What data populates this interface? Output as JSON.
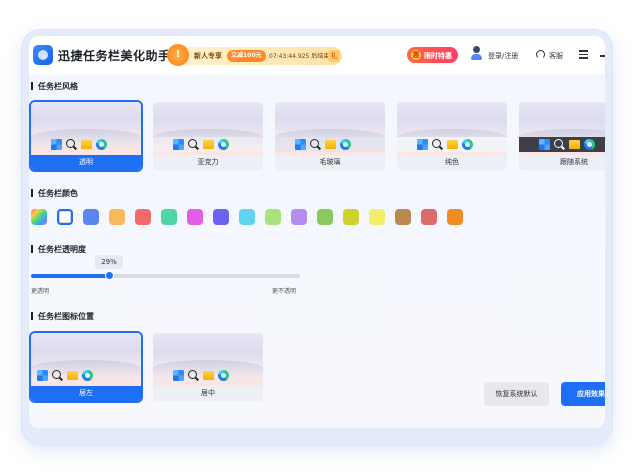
{
  "header": {
    "app_title": "迅捷任务栏美化助手",
    "promo_badge": "!",
    "promo_label": "新人专享",
    "promo_cta": "立减100元",
    "promo_timer": "07:43:44.925 后结束",
    "promo_tail": "礼",
    "limited_icon": "惠",
    "limited_label": "限时特惠",
    "login_label": "登录/注册",
    "service_label": "客服"
  },
  "sections": {
    "style_title": "任务栏风格",
    "color_title": "任务栏颜色",
    "opacity_title": "任务栏透明度",
    "position_title": "任务栏图标位置"
  },
  "styles": [
    {
      "label": "透明",
      "selected": true
    },
    {
      "label": "亚克力",
      "selected": false
    },
    {
      "label": "毛玻璃",
      "selected": false
    },
    {
      "label": "纯色",
      "selected": false
    },
    {
      "label": "跟随系统",
      "selected": false
    }
  ],
  "colors": [
    "rainbow",
    "#ffffff",
    "#5b86f2",
    "#fbb857",
    "#f46b6b",
    "#4fd6a6",
    "#e45de6",
    "#6c63f0",
    "#5fd4f0",
    "#a9e37e",
    "#b68cf0",
    "#8cc95c",
    "#cdd12a",
    "#f1ef6a",
    "#b98a4e",
    "#de6b6b",
    "#f08a24"
  ],
  "opacity": {
    "value_label": "29%",
    "value": 29,
    "min_label": "更透明",
    "max_label": "更不透明"
  },
  "positions": [
    {
      "label": "居左",
      "selected": true
    },
    {
      "label": "居中",
      "selected": false
    }
  ],
  "buttons": {
    "reset": "恢复系统默认",
    "apply": "应用效果"
  },
  "accent": "#1f6ef6"
}
